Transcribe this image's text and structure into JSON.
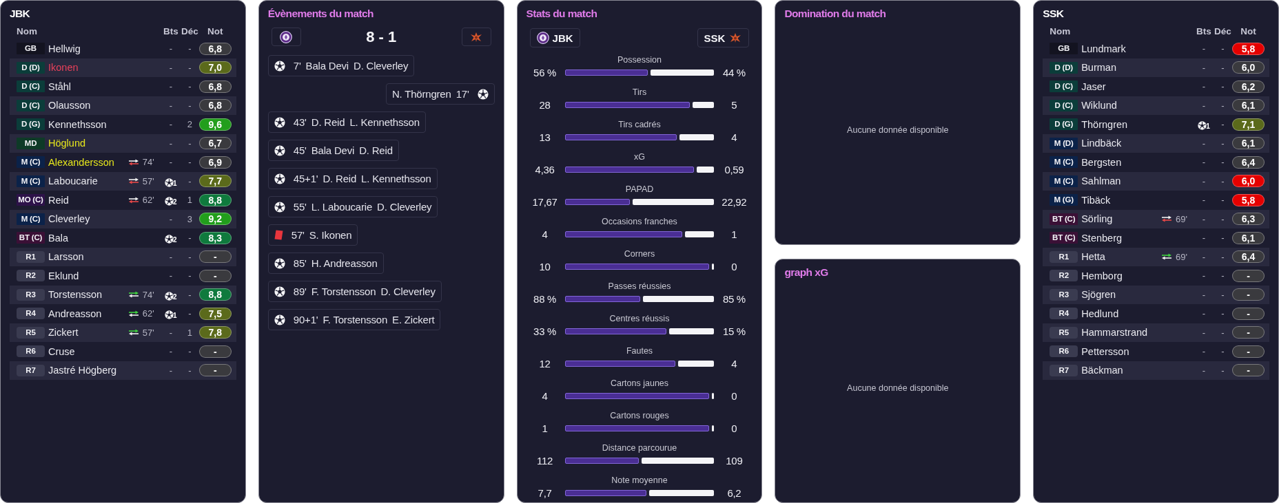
{
  "home_team": {
    "title": "JBK",
    "columns": [
      "Nom",
      "Bts",
      "Déc",
      "Not"
    ],
    "players": [
      {
        "position": {
          "text": "GB",
          "color": "#131320"
        },
        "reserve": false,
        "name": "Hellwig",
        "scored": false,
        "goals": "-",
        "assists": "-",
        "rating": {
          "text": "6,8",
          "color": "#3a3a3e"
        }
      },
      {
        "position": {
          "text": "D (D)",
          "color": "#0b3d3a"
        },
        "reserve": false,
        "name": "Ikonen",
        "card": {
          "color": "#e8405a"
        },
        "scored": false,
        "goals": "-",
        "assists": "-",
        "rating": {
          "text": "7,0",
          "color": "#5b6a1b"
        }
      },
      {
        "position": {
          "text": "D (C)",
          "color": "#0b3d3a"
        },
        "reserve": false,
        "name": "Ståhl",
        "scored": false,
        "goals": "-",
        "assists": "-",
        "rating": {
          "text": "6,8",
          "color": "#3a3a3e"
        }
      },
      {
        "position": {
          "text": "D (C)",
          "color": "#0b3d3a"
        },
        "reserve": false,
        "name": "Olausson",
        "scored": false,
        "goals": "-",
        "assists": "-",
        "rating": {
          "text": "6,8",
          "color": "#3a3a3e"
        }
      },
      {
        "position": {
          "text": "D (G)",
          "color": "#0b3d3a"
        },
        "reserve": false,
        "name": "Kennethsson",
        "scored": false,
        "goals": "-",
        "assists": "2",
        "rating": {
          "text": "9,6",
          "color": "#229e1c"
        }
      },
      {
        "position": {
          "text": "MD",
          "color": "#0e3a27"
        },
        "reserve": false,
        "name": "Höglund",
        "card": {
          "color": "#e6e61c"
        },
        "scored": false,
        "goals": "-",
        "assists": "-",
        "rating": {
          "text": "6,7",
          "color": "#3a3a3e"
        }
      },
      {
        "position": {
          "text": "M (C)",
          "color": "#0b2249"
        },
        "reserve": false,
        "name": "Alexandersson",
        "card": {
          "color": "#e6e61c"
        },
        "sub": {
          "subbed_off": true,
          "minute": "74'"
        },
        "scored": false,
        "goals": "-",
        "assists": "-",
        "rating": {
          "text": "6,9",
          "color": "#3a3a3e"
        }
      },
      {
        "position": {
          "text": "M (C)",
          "color": "#0b2249"
        },
        "reserve": false,
        "name": "Laboucarie",
        "sub": {
          "subbed_off": true,
          "minute": "57'"
        },
        "scored": true,
        "goals": "1",
        "assists": "-",
        "rating": {
          "text": "7,7",
          "color": "#5b6a1b"
        }
      },
      {
        "position": {
          "text": "MO (C)",
          "color": "#2d1249"
        },
        "reserve": false,
        "name": "Reid",
        "sub": {
          "subbed_off": true,
          "minute": "62'"
        },
        "scored": true,
        "goals": "2",
        "assists": "1",
        "rating": {
          "text": "8,8",
          "color": "#0f7a3d"
        }
      },
      {
        "position": {
          "text": "M (C)",
          "color": "#0b2249"
        },
        "reserve": false,
        "name": "Cleverley",
        "scored": false,
        "goals": "-",
        "assists": "3",
        "rating": {
          "text": "9,2",
          "color": "#229e1c"
        }
      },
      {
        "position": {
          "text": "BT (C)",
          "color": "#3b1036"
        },
        "reserve": false,
        "name": "Bala",
        "scored": true,
        "goals": "2",
        "assists": "-",
        "rating": {
          "text": "8,3",
          "color": "#0f7a3d"
        }
      },
      {
        "position": {
          "text": "R1",
          "color": "#3a3b50"
        },
        "reserve": true,
        "name": "Larsson",
        "scored": false,
        "goals": "-",
        "assists": "-",
        "rating": {
          "text": "-",
          "color": "#3a3a3e"
        }
      },
      {
        "position": {
          "text": "R2",
          "color": "#3a3b50"
        },
        "reserve": true,
        "name": "Eklund",
        "scored": false,
        "goals": "-",
        "assists": "-",
        "rating": {
          "text": "-",
          "color": "#3a3a3e"
        }
      },
      {
        "position": {
          "text": "R3",
          "color": "#3a3b50"
        },
        "reserve": true,
        "name": "Torstensson",
        "sub": {
          "subbed_off": false,
          "minute": "74'"
        },
        "scored": true,
        "goals": "2",
        "assists": "-",
        "rating": {
          "text": "8,8",
          "color": "#0f7a3d"
        }
      },
      {
        "position": {
          "text": "R4",
          "color": "#3a3b50"
        },
        "reserve": true,
        "name": "Andreasson",
        "sub": {
          "subbed_off": false,
          "minute": "62'"
        },
        "scored": true,
        "goals": "1",
        "assists": "-",
        "rating": {
          "text": "7,5",
          "color": "#5b6a1b"
        }
      },
      {
        "position": {
          "text": "R5",
          "color": "#3a3b50"
        },
        "reserve": true,
        "name": "Zickert",
        "sub": {
          "subbed_off": false,
          "minute": "57'"
        },
        "scored": false,
        "goals": "-",
        "assists": "1",
        "rating": {
          "text": "7,8",
          "color": "#5b6a1b"
        }
      },
      {
        "position": {
          "text": "R6",
          "color": "#3a3b50"
        },
        "reserve": true,
        "name": "Cruse",
        "scored": false,
        "goals": "-",
        "assists": "-",
        "rating": {
          "text": "-",
          "color": "#3a3a3e"
        }
      },
      {
        "position": {
          "text": "R7",
          "color": "#3a3b50"
        },
        "reserve": true,
        "name": "Jastré Högberg",
        "scored": false,
        "goals": "-",
        "assists": "-",
        "rating": {
          "text": "-",
          "color": "#3a3a3e"
        }
      }
    ]
  },
  "events": {
    "title": "Évènements du match",
    "score": "8 - 1",
    "items": [
      {
        "away": false,
        "kind": "goal",
        "minute": "7'",
        "player": "Bala Devi",
        "assist": "D. Cleverley"
      },
      {
        "away": true,
        "kind": "goal",
        "minute": "17'",
        "player": "N. Thörngren"
      },
      {
        "away": false,
        "kind": "goal",
        "minute": "43'",
        "player": "D. Reid",
        "assist": "L. Kennethsson"
      },
      {
        "away": false,
        "kind": "goal",
        "minute": "45'",
        "player": "Bala Devi",
        "assist": "D. Reid"
      },
      {
        "away": false,
        "kind": "goal",
        "minute": "45+1'",
        "player": "D. Reid",
        "assist": "L. Kennethsson"
      },
      {
        "away": false,
        "kind": "goal",
        "minute": "55'",
        "player": "L. Laboucarie",
        "assist": "D. Cleverley"
      },
      {
        "away": false,
        "kind": "card",
        "minute": "57'",
        "player": "S. Ikonen"
      },
      {
        "away": false,
        "kind": "goal",
        "minute": "85'",
        "player": "H. Andreasson"
      },
      {
        "away": false,
        "kind": "goal",
        "minute": "89'",
        "player": "F. Torstensson",
        "assist": "D. Cleverley"
      },
      {
        "away": false,
        "kind": "goal",
        "minute": "90+1'",
        "player": "F. Torstensson",
        "assist": "E. Zickert"
      }
    ]
  },
  "stats": {
    "title": "Stats du match",
    "home": "JBK",
    "away": "SSK",
    "rows": [
      {
        "label": "Possession",
        "home": "56 %",
        "away": "44 %",
        "level": 0.56
      },
      {
        "label": "Tirs",
        "home": "28",
        "away": "5",
        "level": 0.85
      },
      {
        "label": "Tirs cadrés",
        "home": "13",
        "away": "4",
        "level": 0.76
      },
      {
        "label": "xG",
        "home": "4,36",
        "away": "0,59",
        "level": 0.88
      },
      {
        "label": "PAPAD",
        "home": "17,67",
        "away": "22,92",
        "level": 0.44
      },
      {
        "label": "Occasions franches",
        "home": "4",
        "away": "1",
        "level": 0.8
      },
      {
        "label": "Corners",
        "home": "10",
        "away": "0",
        "level": 1
      },
      {
        "label": "Passes réussies",
        "home": "88 %",
        "away": "85 %",
        "level": 0.51
      },
      {
        "label": "Centres réussis",
        "home": "33 %",
        "away": "15 %",
        "level": 0.69
      },
      {
        "label": "Fautes",
        "home": "12",
        "away": "4",
        "level": 0.75
      },
      {
        "label": "Cartons jaunes",
        "home": "4",
        "away": "0",
        "level": 1
      },
      {
        "label": "Cartons rouges",
        "home": "1",
        "away": "0",
        "level": 1
      },
      {
        "label": "Distance parcourue",
        "home": "112",
        "away": "109",
        "level": 0.5
      },
      {
        "label": "Note moyenne",
        "home": "7,7",
        "away": "6,2",
        "level": 0.55
      }
    ]
  },
  "domination": {
    "title": "Domination du match",
    "empty_text": "Aucune donnée disponible"
  },
  "xg_graph": {
    "title": "graph xG",
    "empty_text": "Aucune donnée disponible"
  },
  "away_team": {
    "title": "SSK",
    "columns": [
      "Nom",
      "Bts",
      "Déc",
      "Not"
    ],
    "players": [
      {
        "position": {
          "text": "GB",
          "color": "#131320"
        },
        "reserve": false,
        "name": "Lundmark",
        "scored": false,
        "goals": "-",
        "assists": "-",
        "rating": {
          "text": "5,8",
          "color": "#e50000"
        }
      },
      {
        "position": {
          "text": "D (D)",
          "color": "#0b3d3a"
        },
        "reserve": false,
        "name": "Burman",
        "scored": false,
        "goals": "-",
        "assists": "-",
        "rating": {
          "text": "6,0",
          "color": "#3a3a3e"
        }
      },
      {
        "position": {
          "text": "D (C)",
          "color": "#0b3d3a"
        },
        "reserve": false,
        "name": "Jaser",
        "scored": false,
        "goals": "-",
        "assists": "-",
        "rating": {
          "text": "6,2",
          "color": "#3a3a3e"
        }
      },
      {
        "position": {
          "text": "D (C)",
          "color": "#0b3d3a"
        },
        "reserve": false,
        "name": "Wiklund",
        "scored": false,
        "goals": "-",
        "assists": "-",
        "rating": {
          "text": "6,1",
          "color": "#3a3a3e"
        }
      },
      {
        "position": {
          "text": "D (G)",
          "color": "#0b3d3a"
        },
        "reserve": false,
        "name": "Thörngren",
        "scored": true,
        "goals": "1",
        "assists": "-",
        "rating": {
          "text": "7,1",
          "color": "#5b6a1b"
        }
      },
      {
        "position": {
          "text": "M (D)",
          "color": "#0b2249"
        },
        "reserve": false,
        "name": "Lindbäck",
        "scored": false,
        "goals": "-",
        "assists": "-",
        "rating": {
          "text": "6,1",
          "color": "#3a3a3e"
        }
      },
      {
        "position": {
          "text": "M (C)",
          "color": "#0b2249"
        },
        "reserve": false,
        "name": "Bergsten",
        "scored": false,
        "goals": "-",
        "assists": "-",
        "rating": {
          "text": "6,4",
          "color": "#3a3a3e"
        }
      },
      {
        "position": {
          "text": "M (C)",
          "color": "#0b2249"
        },
        "reserve": false,
        "name": "Sahlman",
        "scored": false,
        "goals": "-",
        "assists": "-",
        "rating": {
          "text": "6,0",
          "color": "#e50000"
        }
      },
      {
        "position": {
          "text": "M (G)",
          "color": "#0b2249"
        },
        "reserve": false,
        "name": "Tibäck",
        "scored": false,
        "goals": "-",
        "assists": "-",
        "rating": {
          "text": "5,8",
          "color": "#e50000"
        }
      },
      {
        "position": {
          "text": "BT (C)",
          "color": "#3b1036"
        },
        "reserve": false,
        "name": "Sörling",
        "sub": {
          "subbed_off": true,
          "minute": "69'"
        },
        "scored": false,
        "goals": "-",
        "assists": "-",
        "rating": {
          "text": "6,3",
          "color": "#3a3a3e"
        }
      },
      {
        "position": {
          "text": "BT (C)",
          "color": "#3b1036"
        },
        "reserve": false,
        "name": "Stenberg",
        "scored": false,
        "goals": "-",
        "assists": "-",
        "rating": {
          "text": "6,1",
          "color": "#3a3a3e"
        }
      },
      {
        "position": {
          "text": "R1",
          "color": "#3a3b50"
        },
        "reserve": true,
        "name": "Hetta",
        "sub": {
          "subbed_off": false,
          "minute": "69'"
        },
        "scored": false,
        "goals": "-",
        "assists": "-",
        "rating": {
          "text": "6,4",
          "color": "#3a3a3e"
        }
      },
      {
        "position": {
          "text": "R2",
          "color": "#3a3b50"
        },
        "reserve": true,
        "name": "Hemborg",
        "scored": false,
        "goals": "-",
        "assists": "-",
        "rating": {
          "text": "-",
          "color": "#3a3a3e"
        }
      },
      {
        "position": {
          "text": "R3",
          "color": "#3a3b50"
        },
        "reserve": true,
        "name": "Sjögren",
        "scored": false,
        "goals": "-",
        "assists": "-",
        "rating": {
          "text": "-",
          "color": "#3a3a3e"
        }
      },
      {
        "position": {
          "text": "R4",
          "color": "#3a3b50"
        },
        "reserve": true,
        "name": "Hedlund",
        "scored": false,
        "goals": "-",
        "assists": "-",
        "rating": {
          "text": "-",
          "color": "#3a3a3e"
        }
      },
      {
        "position": {
          "text": "R5",
          "color": "#3a3b50"
        },
        "reserve": true,
        "name": "Hammarstrand",
        "scored": false,
        "goals": "-",
        "assists": "-",
        "rating": {
          "text": "-",
          "color": "#3a3a3e"
        }
      },
      {
        "position": {
          "text": "R6",
          "color": "#3a3b50"
        },
        "reserve": true,
        "name": "Pettersson",
        "scored": false,
        "goals": "-",
        "assists": "-",
        "rating": {
          "text": "-",
          "color": "#3a3a3e"
        }
      },
      {
        "position": {
          "text": "R7",
          "color": "#3a3b50"
        },
        "reserve": true,
        "name": "Bäckman",
        "scored": false,
        "goals": "-",
        "assists": "-",
        "rating": {
          "text": "-",
          "color": "#3a3a3e"
        }
      }
    ]
  }
}
